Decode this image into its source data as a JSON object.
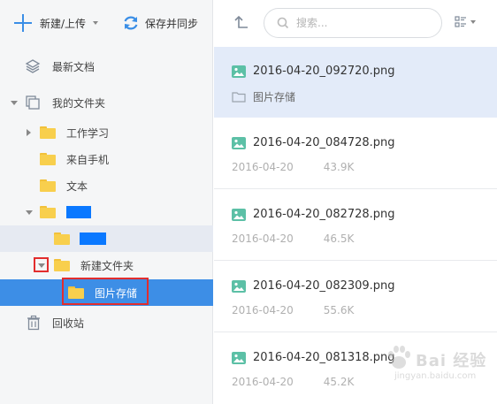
{
  "toolbar": {
    "new_upload_label": "新建/上传",
    "sync_label": "保存并同步"
  },
  "sidebar": {
    "recent_label": "最新文档",
    "my_folders_label": "我的文件夹",
    "folders": [
      {
        "label": "工作学习"
      },
      {
        "label": "来自手机"
      },
      {
        "label": "文本"
      }
    ],
    "new_folder_label": "新建文件夹",
    "selected_folder_label": "图片存储",
    "trash_label": "回收站"
  },
  "topbar": {
    "search_placeholder": "搜索..."
  },
  "files": [
    {
      "name": "2016-04-20_092720.png",
      "path": "图片存储"
    },
    {
      "name": "2016-04-20_084728.png",
      "date": "2016-04-20",
      "size": "43.9K"
    },
    {
      "name": "2016-04-20_082728.png",
      "date": "2016-04-20",
      "size": "46.5K"
    },
    {
      "name": "2016-04-20_082309.png",
      "date": "2016-04-20",
      "size": "55.6K"
    },
    {
      "name": "2016-04-20_081318.png",
      "date": "2016-04-20",
      "size": "45.2K"
    }
  ],
  "watermark": {
    "main": "Bai 经验",
    "sub": "jingyan.baidu.com"
  },
  "colors": {
    "accent": "#3d8ee6",
    "redacted": "#0a78ff",
    "highlight_box": "#e22d2d",
    "image_icon": "#5cc0a6",
    "folder": "#f8cf4d"
  }
}
